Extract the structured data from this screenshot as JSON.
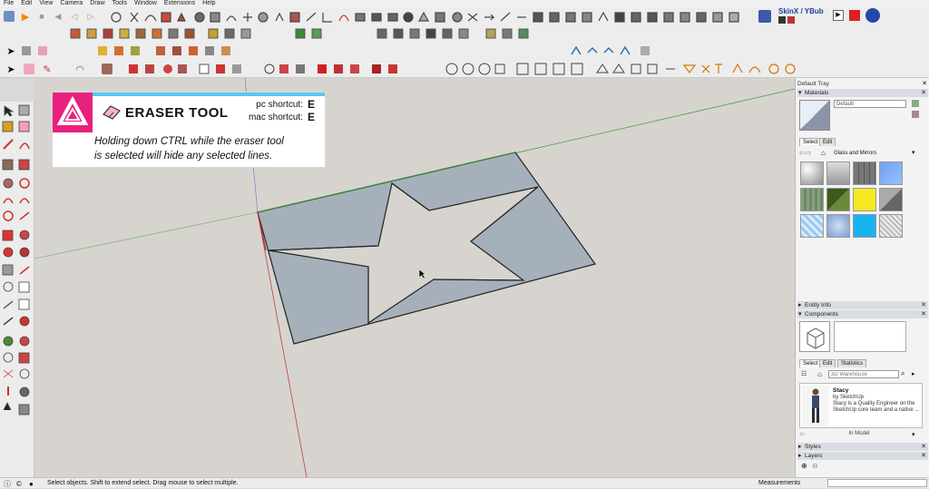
{
  "menu": [
    "File",
    "Edit",
    "View",
    "Camera",
    "Draw",
    "Tools",
    "Window",
    "Extensions",
    "Help"
  ],
  "toolbar": {
    "skin_plugin_label": "SkinX / YBub"
  },
  "overlay": {
    "tool_name": "ERASER TOOL",
    "pc_shortcut_label": "pc shortcut:",
    "pc_shortcut_key": "E",
    "mac_shortcut_label": "mac shortcut:",
    "mac_shortcut_key": "E",
    "tip_line1": "Holding down CTRL while the  eraser  tool",
    "tip_line2": "is selected will hide any selected lines.",
    "accent_color": "#e8217f"
  },
  "tray": {
    "title": "Default Tray",
    "materials": {
      "header": "Materials",
      "current_material": "Default",
      "tabs": [
        "Select",
        "Edit"
      ],
      "collection": "Glass and Mirrors"
    },
    "entity_info": {
      "header": "Entity Info"
    },
    "components": {
      "header": "Components",
      "tabs": [
        "Select",
        "Edit",
        "Statistics"
      ],
      "search_placeholder": "3D Warehouse",
      "result": {
        "name": "Stacy",
        "author": "by SketchUp",
        "description_line1": "Stacy is a Quality Engineer on the",
        "description_line2": "SketchUp core team and a native ..."
      },
      "in_model_label": "In Model"
    },
    "styles": {
      "header": "Styles"
    },
    "layers": {
      "header": "Layers"
    }
  },
  "status": {
    "hint": "Select objects. Shift to extend select. Drag mouse to select multiple.",
    "measurements_label": "Measurements"
  }
}
